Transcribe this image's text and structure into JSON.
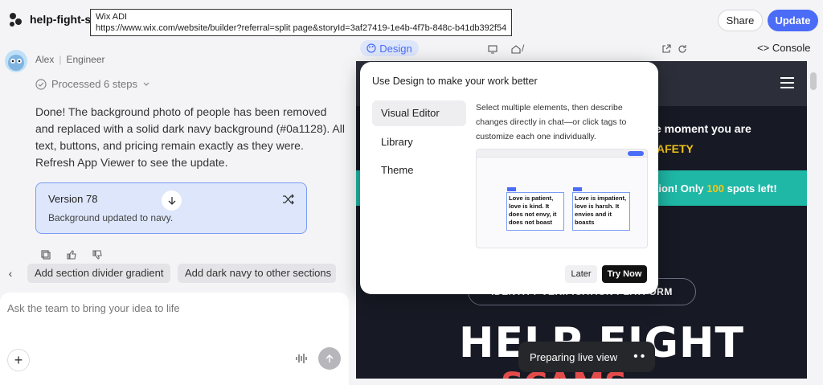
{
  "app": {
    "project_name": "help-fight-sc",
    "share_label": "Share",
    "update_label": "Update"
  },
  "tooltip": {
    "title": "Wix ADI",
    "url": "https://www.wix.com/website/builder?referral=split page&storyId=3af27419-1e4b-4f7b-848c-b41db392f54..."
  },
  "chat": {
    "author": "Alex",
    "role": "Engineer",
    "processed": "Processed 6 steps",
    "message": "Done! The background photo of people has been removed and replaced with a solid dark navy background (#0a1128). All text, buttons, and pricing remain exactly as they were. Refresh App Viewer to see the update.",
    "version_title": "Version 78",
    "version_subtitle": "Background updated to navy.",
    "suggestions": [
      "Add section divider gradient",
      "Add dark navy to other sections"
    ],
    "composer_placeholder": "Ask the team to bring your idea to life"
  },
  "preview": {
    "design_tab": "Design",
    "path": "/",
    "console_tab": "Console",
    "live_status": "Preparing live view",
    "site": {
      "hero_line1": "e moment you are",
      "hero_line2": "AFETY",
      "cta_prefix": "tion! Only ",
      "cta_number": "100",
      "cta_suffix": " spots left!",
      "pill_text": "IDENTITY VERIFICATION PLATFORM",
      "big_title": "HELP FIGHT",
      "big_title_2": "SCAMS"
    }
  },
  "popup": {
    "title": "Use Design to make your work better",
    "nav": [
      "Visual Editor",
      "Library",
      "Theme"
    ],
    "description": "Select multiple elements, then describe changes directly in chat—or click tags to customize each one individually.",
    "card_left": "Love is patient, love is kind. It does not envy, it does not boast",
    "card_right": "Love is impatient, love is harsh. It envies and it boasts",
    "later_label": "Later",
    "try_label": "Try Now"
  },
  "colors": {
    "accent": "#4a6cf7",
    "site_bg": "#171a24",
    "cta_band": "#1fb8a6",
    "highlight": "#f5c518"
  }
}
